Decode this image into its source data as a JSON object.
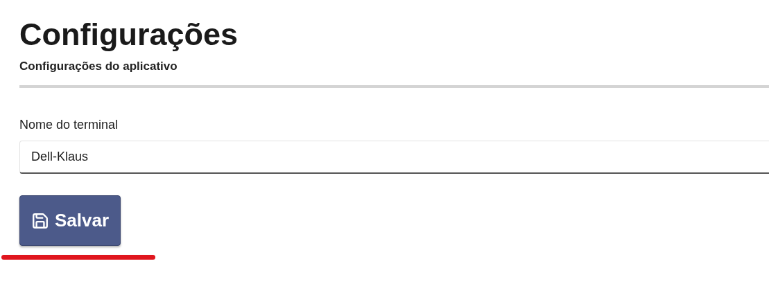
{
  "title": "Configurações",
  "subtitle": "Configurações do aplicativo",
  "field": {
    "label": "Nome do terminal",
    "value": "Dell-Klaus"
  },
  "save_button": {
    "label": "Salvar"
  },
  "annotations": [
    {
      "kind": "underline"
    }
  ]
}
